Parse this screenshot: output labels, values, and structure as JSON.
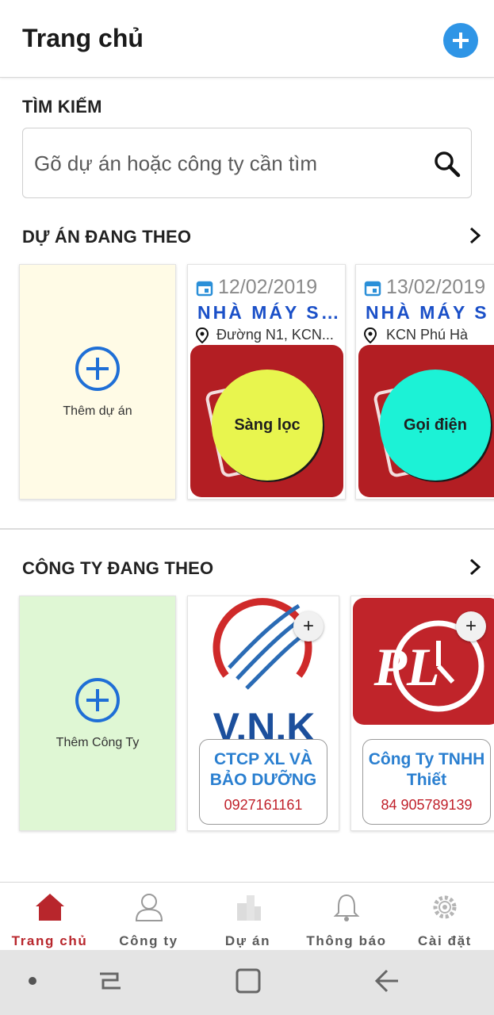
{
  "header": {
    "title": "Trang chủ",
    "add_icon": "plus-circle-icon"
  },
  "search": {
    "heading": "TÌM KIẾM",
    "placeholder": "Gõ dự án hoặc công ty cần tìm"
  },
  "projects": {
    "heading": "DỰ ÁN ĐANG THEO",
    "add_label": "Thêm dự án",
    "items": [
      {
        "date": "12/02/2019",
        "name": "NHÀ MÁY SẢN XUẤT",
        "address": "Đường N1, KCN...",
        "action": "Sàng lọc",
        "action_color": "#e8f54e"
      },
      {
        "date": "13/02/2019",
        "name": "NHÀ MÁY S",
        "address": "KCN Phú Hà",
        "action": "Gọi điện",
        "action_color": "#1cf2d6"
      }
    ]
  },
  "companies": {
    "heading": "CÔNG TY ĐANG THEO",
    "add_label": "Thêm Công Ty",
    "items": [
      {
        "logo_text": "V.N.K",
        "name": "CTCP XL VÀ BẢO DƯỠNG",
        "phone": "0927161161"
      },
      {
        "logo_text": "PL",
        "name": "Công Ty TNHH Thiết",
        "phone": "84 905789139"
      }
    ]
  },
  "bottom_nav": [
    {
      "label": "Trang chủ",
      "icon": "home-icon",
      "active": true
    },
    {
      "label": "Công ty",
      "icon": "user-icon",
      "active": false
    },
    {
      "label": "Dự án",
      "icon": "building-icon",
      "active": false
    },
    {
      "label": "Thông báo",
      "icon": "bell-icon",
      "active": false
    },
    {
      "label": "Cài đặt",
      "icon": "gear-icon",
      "active": false
    }
  ],
  "colors": {
    "accent": "#2f95e6",
    "brand_red": "#b8262c",
    "project_name": "#1b50c8"
  }
}
